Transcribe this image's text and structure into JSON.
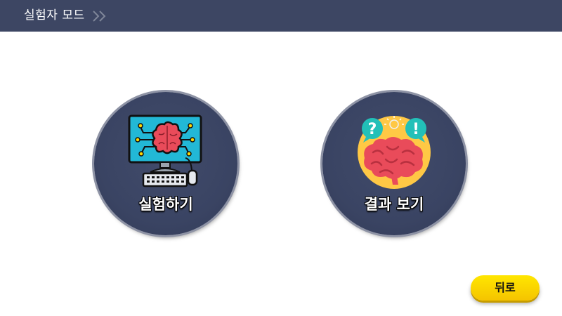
{
  "header": {
    "title": "실험자 모드",
    "chevron_icon": "double-chevron-right-icon",
    "background": "#3d4663"
  },
  "modes": [
    {
      "label": "실험하기",
      "icon": "computer-brain-icon"
    },
    {
      "label": "결과 보기",
      "icon": "brain-question-icon"
    }
  ],
  "back_button": {
    "label": "뒤로",
    "color": "#ffd800"
  },
  "colors": {
    "circle": "#3a4463",
    "screen": "#22b8d6",
    "brain": "#e94b5a",
    "sun": "#ffc845",
    "badge": "#22c0b8"
  }
}
